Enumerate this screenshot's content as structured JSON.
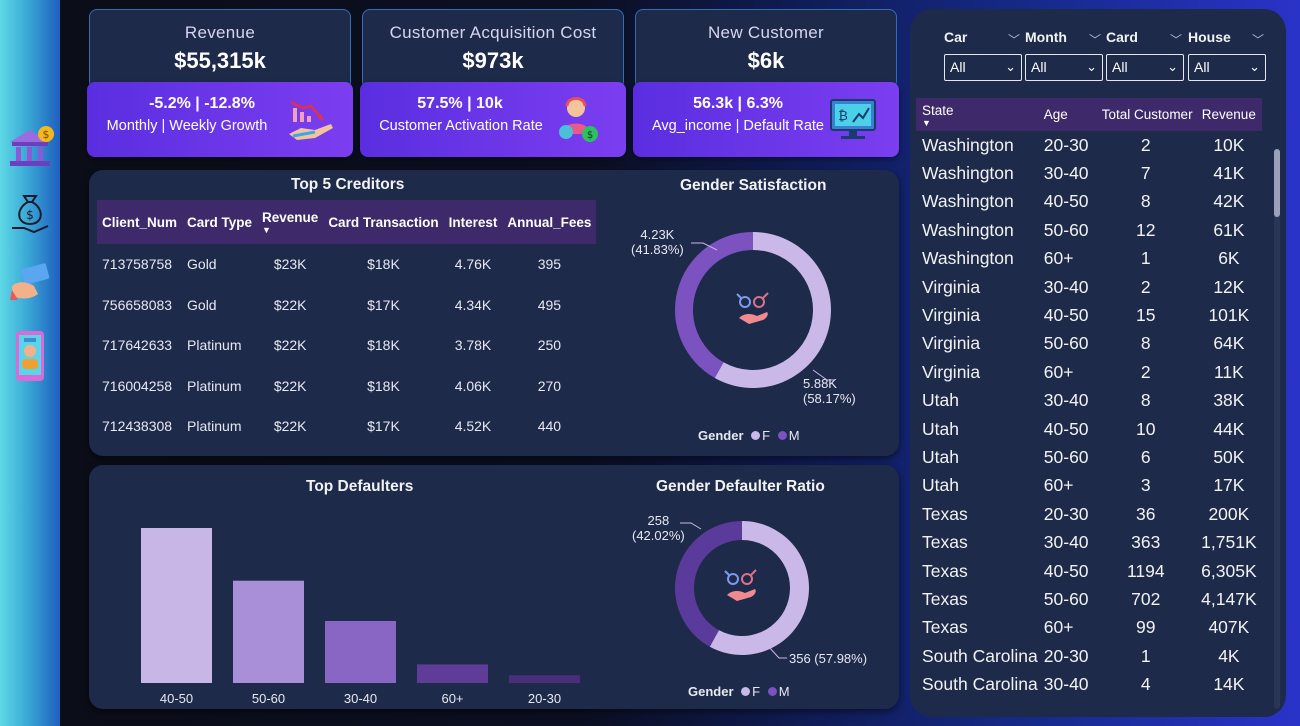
{
  "kpis": [
    {
      "title": "Revenue",
      "value": "$55,315k",
      "sub_value": "-5.2% | -12.8%",
      "sub_label": "Monthly | Weekly Growth",
      "icon": "declining-chart-hand-icon"
    },
    {
      "title": "Customer Acquisition Cost",
      "value": "$973k",
      "sub_value": "57.5% | 10k",
      "sub_label": "Customer Activation Rate",
      "icon": "customer-support-icon"
    },
    {
      "title": "New Customer",
      "value": "$6k",
      "sub_value": "56.3k | 6.3%",
      "sub_label": "Avg_income | Default Rate",
      "icon": "monitor-chart-icon"
    }
  ],
  "sidebar_icons": [
    "bank-icon",
    "money-bag-hand-icon",
    "credit-card-hand-icon",
    "mobile-user-icon"
  ],
  "creditors": {
    "title": "Top 5 Creditors",
    "columns": [
      "Client_Num",
      "Card Type",
      "Revenue",
      "Card Transaction",
      "Interest",
      "Annual_Fees"
    ],
    "rows": [
      [
        "713758758",
        "Gold",
        "$23K",
        "$18K",
        "4.76K",
        "395"
      ],
      [
        "756658083",
        "Gold",
        "$22K",
        "$17K",
        "4.34K",
        "495"
      ],
      [
        "717642633",
        "Platinum",
        "$22K",
        "$18K",
        "3.78K",
        "250"
      ],
      [
        "716004258",
        "Platinum",
        "$22K",
        "$18K",
        "4.06K",
        "270"
      ],
      [
        "712438308",
        "Platinum",
        "$22K",
        "$17K",
        "4.52K",
        "440"
      ]
    ]
  },
  "gender_satisfaction": {
    "title": "Gender Satisfaction",
    "label_f_value": "5.88K",
    "label_f_pct": "(58.17%)",
    "label_m_value": "4.23K",
    "label_m_pct": "(41.83%)",
    "legend_title": "Gender",
    "legend_f": "F",
    "legend_m": "M"
  },
  "gender_defaulter": {
    "title": "Gender Defaulter Ratio",
    "label_f": "356 (57.98%)",
    "label_m_value": "258",
    "label_m_pct": "(42.02%)",
    "legend_title": "Gender",
    "legend_f": "F",
    "legend_m": "M"
  },
  "defaulters_title": "Top Defaulters",
  "colors": {
    "f": "#c9b8e8",
    "m": "#7b52c0",
    "m_dark": "#5a3a9a",
    "bar_scale": [
      "#c8b6e6",
      "#a88fd8",
      "#8a66c4",
      "#5e3c98",
      "#4a2e7c"
    ]
  },
  "slicers": [
    {
      "label": "Car",
      "value": "All"
    },
    {
      "label": "Month",
      "value": "All"
    },
    {
      "label": "Card",
      "value": "All"
    },
    {
      "label": "House",
      "value": "All"
    }
  ],
  "state_table": {
    "columns": [
      "State",
      "Age",
      "Total Customer",
      "Revenue"
    ],
    "rows": [
      [
        "Washington",
        "20-30",
        "2",
        "10K"
      ],
      [
        "Washington",
        "30-40",
        "7",
        "41K"
      ],
      [
        "Washington",
        "40-50",
        "8",
        "42K"
      ],
      [
        "Washington",
        "50-60",
        "12",
        "61K"
      ],
      [
        "Washington",
        "60+",
        "1",
        "6K"
      ],
      [
        "Virginia",
        "30-40",
        "2",
        "12K"
      ],
      [
        "Virginia",
        "40-50",
        "15",
        "101K"
      ],
      [
        "Virginia",
        "50-60",
        "8",
        "64K"
      ],
      [
        "Virginia",
        "60+",
        "2",
        "11K"
      ],
      [
        "Utah",
        "30-40",
        "8",
        "38K"
      ],
      [
        "Utah",
        "40-50",
        "10",
        "44K"
      ],
      [
        "Utah",
        "50-60",
        "6",
        "50K"
      ],
      [
        "Utah",
        "60+",
        "3",
        "17K"
      ],
      [
        "Texas",
        "20-30",
        "36",
        "200K"
      ],
      [
        "Texas",
        "30-40",
        "363",
        "1,751K"
      ],
      [
        "Texas",
        "40-50",
        "1194",
        "6,305K"
      ],
      [
        "Texas",
        "50-60",
        "702",
        "4,147K"
      ],
      [
        "Texas",
        "60+",
        "99",
        "407K"
      ],
      [
        "South Carolina",
        "20-30",
        "1",
        "4K"
      ],
      [
        "South Carolina",
        "30-40",
        "4",
        "14K"
      ]
    ]
  },
  "chart_data": [
    {
      "type": "bar",
      "title": "Top Defaulters",
      "categories": [
        "40-50",
        "50-60",
        "30-40",
        "60+",
        "20-30"
      ],
      "values": [
        100,
        66,
        40,
        12,
        5
      ],
      "xlabel": "",
      "ylabel": "",
      "grid": false
    },
    {
      "type": "pie",
      "title": "Gender Satisfaction",
      "categories": [
        "F",
        "M"
      ],
      "values": [
        5880,
        4230
      ],
      "percent": [
        58.17,
        41.83
      ]
    },
    {
      "type": "pie",
      "title": "Gender Defaulter Ratio",
      "categories": [
        "F",
        "M"
      ],
      "values": [
        356,
        258
      ],
      "percent": [
        57.98,
        42.02
      ]
    }
  ]
}
